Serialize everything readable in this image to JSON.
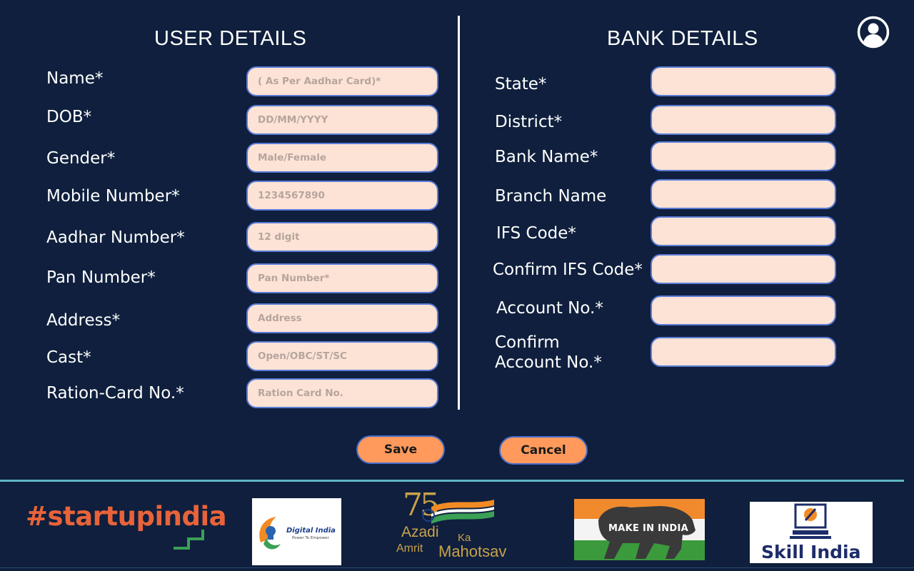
{
  "user_section": {
    "title": "USER DETAILS",
    "fields": [
      {
        "label": "Name*",
        "placeholder": "( As Per Aadhar Card)*"
      },
      {
        "label": "DOB*",
        "placeholder": "DD/MM/YYYY"
      },
      {
        "label": "Gender*",
        "placeholder": "Male/Female"
      },
      {
        "label": "Mobile Number*",
        "placeholder": "1234567890"
      },
      {
        "label": "Aadhar Number*",
        "placeholder": "12 digit"
      },
      {
        "label": "Pan Number*",
        "placeholder": "Pan Number*"
      },
      {
        "label": "Address*",
        "placeholder": "Address"
      },
      {
        "label": "Cast*",
        "placeholder": "Open/OBC/ST/SC"
      },
      {
        "label": "Ration-Card No.*",
        "placeholder": "Ration Card No."
      }
    ]
  },
  "bank_section": {
    "title": "BANK DETAILS",
    "fields": [
      {
        "label": "State*",
        "placeholder": ""
      },
      {
        "label": "District*",
        "placeholder": ""
      },
      {
        "label": "Bank Name*",
        "placeholder": ""
      },
      {
        "label": "Branch Name",
        "placeholder": ""
      },
      {
        "label": "IFS Code*",
        "placeholder": ""
      },
      {
        "label": "Confirm IFS Code*",
        "placeholder": ""
      },
      {
        "label": "Account No.*",
        "placeholder": ""
      },
      {
        "label_line1": "Confirm",
        "label_line2": "Account No.*",
        "placeholder": ""
      }
    ]
  },
  "actions": {
    "save_label": "Save",
    "cancel_label": "Cancel"
  },
  "header": {
    "profile_icon": "user-circle-icon"
  },
  "footer_logos": {
    "startup": {
      "text_main": "#startupindia",
      "text_accent": "a"
    },
    "digital_india": {
      "title": "Digital India",
      "tagline": "Power To Empower"
    },
    "azadi": {
      "number": "75",
      "line1": "Azadi",
      "ka": "Ka",
      "line2": "Amrit",
      "line3": "Mahotsav"
    },
    "make_in_india": {
      "text": "MAKE IN INDIA"
    },
    "skill_india": {
      "text": "Skill India"
    }
  },
  "colors": {
    "background": "#0f1f3d",
    "input_fill": "#fde3d6",
    "input_border": "#5a7bd6",
    "button_fill": "#ff9a5c",
    "footer_rule": "#5fb8c4"
  }
}
